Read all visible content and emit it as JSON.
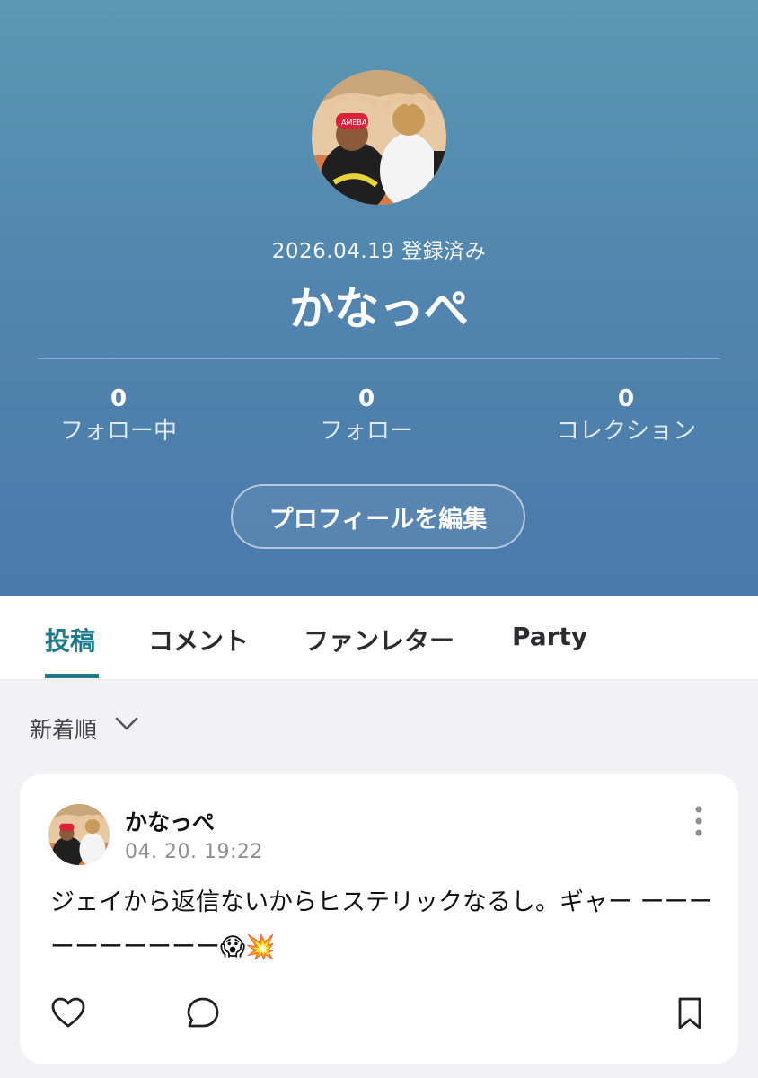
{
  "profile": {
    "registered_text": "2026.04.19 登録済み",
    "name": "かなっぺ",
    "stats": [
      {
        "value": "0",
        "label": "フォロー中"
      },
      {
        "value": "0",
        "label": "フォロー"
      },
      {
        "value": "0",
        "label": "コレクション"
      }
    ],
    "edit_button": "プロフィールを編集"
  },
  "tabs": [
    {
      "label": "投稿",
      "active": true
    },
    {
      "label": "コメント",
      "active": false
    },
    {
      "label": "ファンレター",
      "active": false
    },
    {
      "label": "Party",
      "active": false
    }
  ],
  "sort": {
    "label": "新着順",
    "icon": "chevron-down-icon"
  },
  "post": {
    "author": "かなっぺ",
    "time": "04. 20. 19:22",
    "text": "ジェイから返信ないからヒステリックなるし。ギャー ーーーーーーーーーー😱💥",
    "actions": [
      "heart-icon",
      "comment-icon",
      "bookmark-icon"
    ]
  },
  "colors": {
    "accent": "#1f7a8c",
    "header_top": "#5a98b4",
    "header_bottom": "#4a79ab"
  }
}
